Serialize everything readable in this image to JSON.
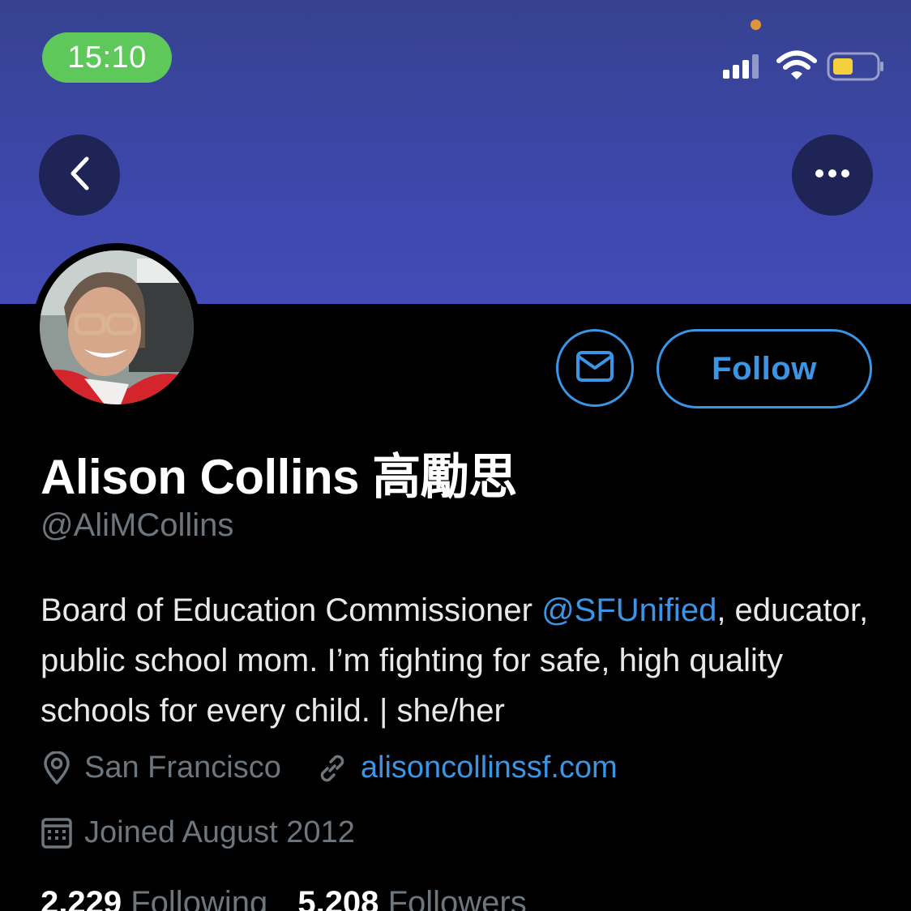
{
  "status_bar": {
    "time": "15:10",
    "icons": [
      "cellular-signal-icon",
      "wifi-icon",
      "battery-icon"
    ],
    "battery_color": "#f5cf3c",
    "time_pill_color": "#5fc85b"
  },
  "banner": {
    "color": "#3d47ab"
  },
  "nav": {
    "back_icon": "chevron-left-icon",
    "more_icon": "more-horizontal-icon"
  },
  "profile": {
    "avatar_alt": "profile photo",
    "message_icon": "envelope-icon",
    "follow_label": "Follow",
    "name": "Alison Collins 高勵思",
    "handle": "@AliMCollins",
    "bio_before": "Board of Education Commissioner ",
    "bio_mention": "@SFUnified",
    "bio_after": ", educator, public school mom. I’m fighting for safe, high quality schools for every child. | she/her",
    "location_icon": "location-pin-icon",
    "location": "San Francisco",
    "link_icon": "link-icon",
    "website": "alisoncollinssf.com",
    "calendar_icon": "calendar-icon",
    "joined": "Joined August 2012",
    "following_count": "2,229",
    "following_label": "Following",
    "followers_count": "5,208",
    "followers_label": "Followers"
  },
  "colors": {
    "accent": "#3b95e6",
    "secondary_text": "#6e767d",
    "background": "#000000"
  }
}
